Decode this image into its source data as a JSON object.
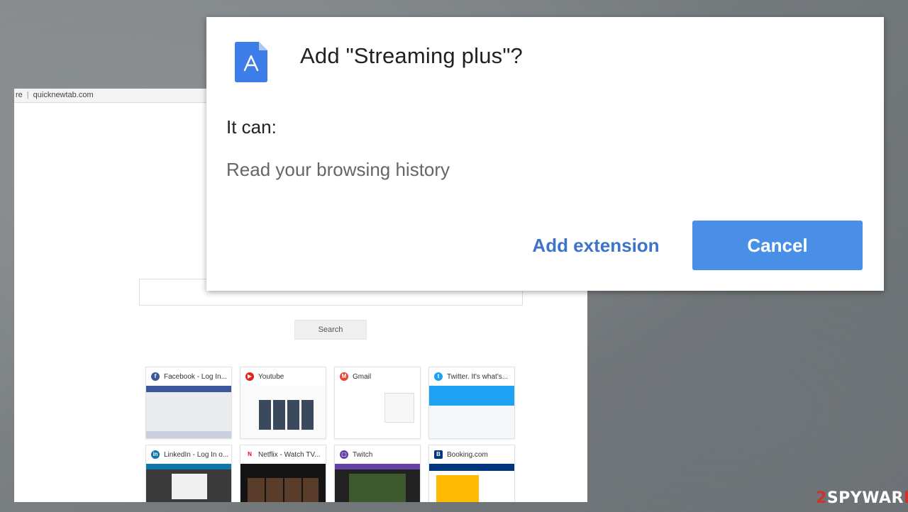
{
  "browser": {
    "address_prefix": "re",
    "address_url": "quicknewtab.com"
  },
  "newtab": {
    "search_button_label": "Search",
    "tiles": [
      {
        "label": "Facebook - Log In...",
        "icon": "facebook-icon",
        "color": "#3b5998",
        "glyph": "f",
        "thumb": "thumb-fb"
      },
      {
        "label": "Youtube",
        "icon": "youtube-icon",
        "color": "#e62117",
        "glyph": "▶",
        "thumb": "thumb-yt"
      },
      {
        "label": "Gmail",
        "icon": "gmail-icon",
        "color": "#ea4335",
        "glyph": "M",
        "thumb": "thumb-gm"
      },
      {
        "label": "Twitter. It's what's...",
        "icon": "twitter-icon",
        "color": "#1da1f2",
        "glyph": "t",
        "thumb": "thumb-tw"
      },
      {
        "label": "LinkedIn - Log In o...",
        "icon": "linkedin-icon",
        "color": "#0e76a8",
        "glyph": "in",
        "thumb": "thumb-li"
      },
      {
        "label": "Netflix - Watch TV...",
        "icon": "netflix-icon",
        "color": "#e50914",
        "glyph": "N",
        "thumb": "thumb-nf"
      },
      {
        "label": "Twitch",
        "icon": "twitch-icon",
        "color": "#6441a5",
        "glyph": "▢",
        "thumb": "thumb-tv"
      },
      {
        "label": "Booking.com",
        "icon": "booking-icon",
        "color": "#003580",
        "glyph": "B",
        "thumb": "thumb-bk"
      }
    ]
  },
  "dialog": {
    "title": "Add \"Streaming plus\"?",
    "it_can_label": "It can:",
    "permission": "Read your browsing history",
    "add_extension_label": "Add extension",
    "cancel_label": "Cancel",
    "icon": "app-store-icon",
    "icon_color": "#3d7de8",
    "accent_color": "#4a8fe7"
  },
  "watermark": {
    "prefix": "2",
    "middle": "SPYWAR",
    "suffix": "E"
  }
}
